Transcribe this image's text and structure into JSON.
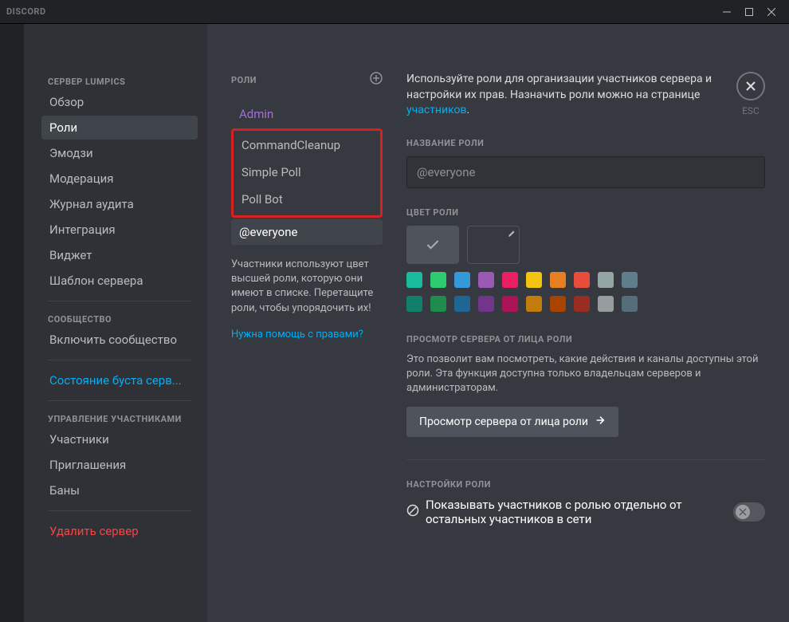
{
  "titlebar": {
    "brand": "DISCORD"
  },
  "sidebar": {
    "server_header": "СЕРВЕР LUMPICS",
    "items1": [
      "Обзор",
      "Роли",
      "Эмодзи",
      "Модерация",
      "Журнал аудита",
      "Интеграция",
      "Виджет",
      "Шаблон сервера"
    ],
    "community_header": "СООБЩЕСТВО",
    "community_item": "Включить сообщество",
    "boost_item": "Состояние буста серв...",
    "members_header": "УПРАВЛЕНИЕ УЧАСТНИКАМИ",
    "members_items": [
      "Участники",
      "Приглашения",
      "Баны"
    ],
    "delete_server": "Удалить сервер"
  },
  "roles": {
    "header": "РОЛИ",
    "list": [
      "Admin",
      "CommandCleanup",
      "Simple Poll",
      "Poll Bot",
      "@everyone"
    ],
    "help_text": "Участники используют цвет высшей роли, которую они имеют в списке. Перетащите роли, чтобы упорядочить их!",
    "help_link": "Нужна помощь с правами?"
  },
  "detail": {
    "intro_pre": "Используйте роли для организации участников сервера и настройки их прав. Назначить роли можно на странице ",
    "intro_link": "участников",
    "intro_post": ".",
    "name_label": "НАЗВАНИЕ РОЛИ",
    "name_value": "@everyone",
    "color_label": "ЦВЕТ РОЛИ",
    "colors_row_a": [
      "#1abc9c",
      "#2ecc71",
      "#3498db",
      "#9b59b6",
      "#e91e63",
      "#f1c40f",
      "#e67e22",
      "#e74c3c",
      "#95a5a6",
      "#607d8b"
    ],
    "colors_row_b": [
      "#11806a",
      "#1f8b4c",
      "#206694",
      "#71368a",
      "#ad1457",
      "#c27c0e",
      "#a84300",
      "#992d22",
      "#979c9f",
      "#546e7a"
    ],
    "preview_label": "ПРОСМОТР СЕРВЕРА ОТ ЛИЦА РОЛИ",
    "preview_desc": "Это позволит вам посмотреть, какие действия и каналы доступны этой роли. Эта функция доступна только владельцам серверов и администраторам.",
    "preview_btn": "Просмотр сервера от лица роли",
    "settings_label": "НАСТРОЙКИ РОЛИ",
    "toggle1_label": "Показывать участников с ролью отдельно от остальных участников в сети"
  },
  "close": {
    "label": "ESC"
  }
}
